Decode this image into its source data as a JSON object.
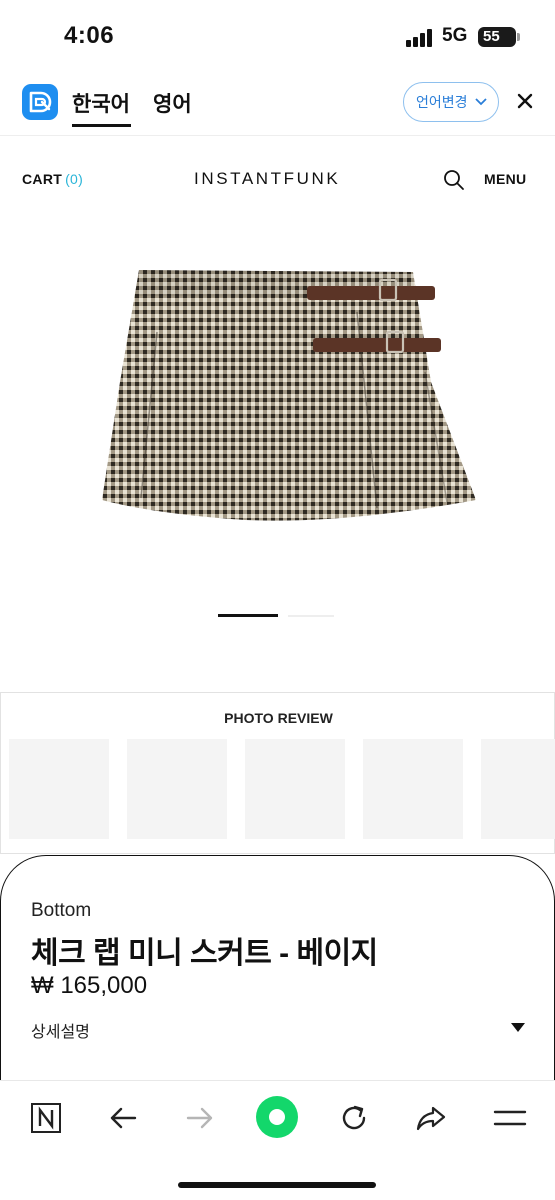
{
  "status_bar": {
    "time": "4:06",
    "network": "5G",
    "battery": "55"
  },
  "translate_bar": {
    "language_active": "한국어",
    "language_other": "영어",
    "change_button": "언어변경",
    "colors": {
      "accent": "#1e8ef0",
      "button_text": "#2a7ed8"
    }
  },
  "header": {
    "cart_label": "CART",
    "cart_count": "(0)",
    "brand": "INSTANTFUNK",
    "menu_label": "MENU",
    "colors": {
      "cart_count": "#2bb5d8"
    }
  },
  "product_image": {
    "icon": "checked-wrap-mini-skirt-image"
  },
  "carousel": {
    "current": 1,
    "total": 2
  },
  "photo_review": {
    "title": "PHOTO REVIEW",
    "thumbnail_count": 5
  },
  "product": {
    "category": "Bottom",
    "title": "체크 랩 미니 스커트 - 베이지",
    "price": "₩ 165,000",
    "description_label": "상세설명"
  },
  "browser_toolbar": {
    "icons": [
      "naver-n-icon",
      "back-arrow-icon",
      "forward-arrow-icon",
      "green-dot-home-icon",
      "reload-icon",
      "share-icon",
      "hamburger-menu-icon"
    ],
    "colors": {
      "home_button": "#13d76b"
    }
  }
}
